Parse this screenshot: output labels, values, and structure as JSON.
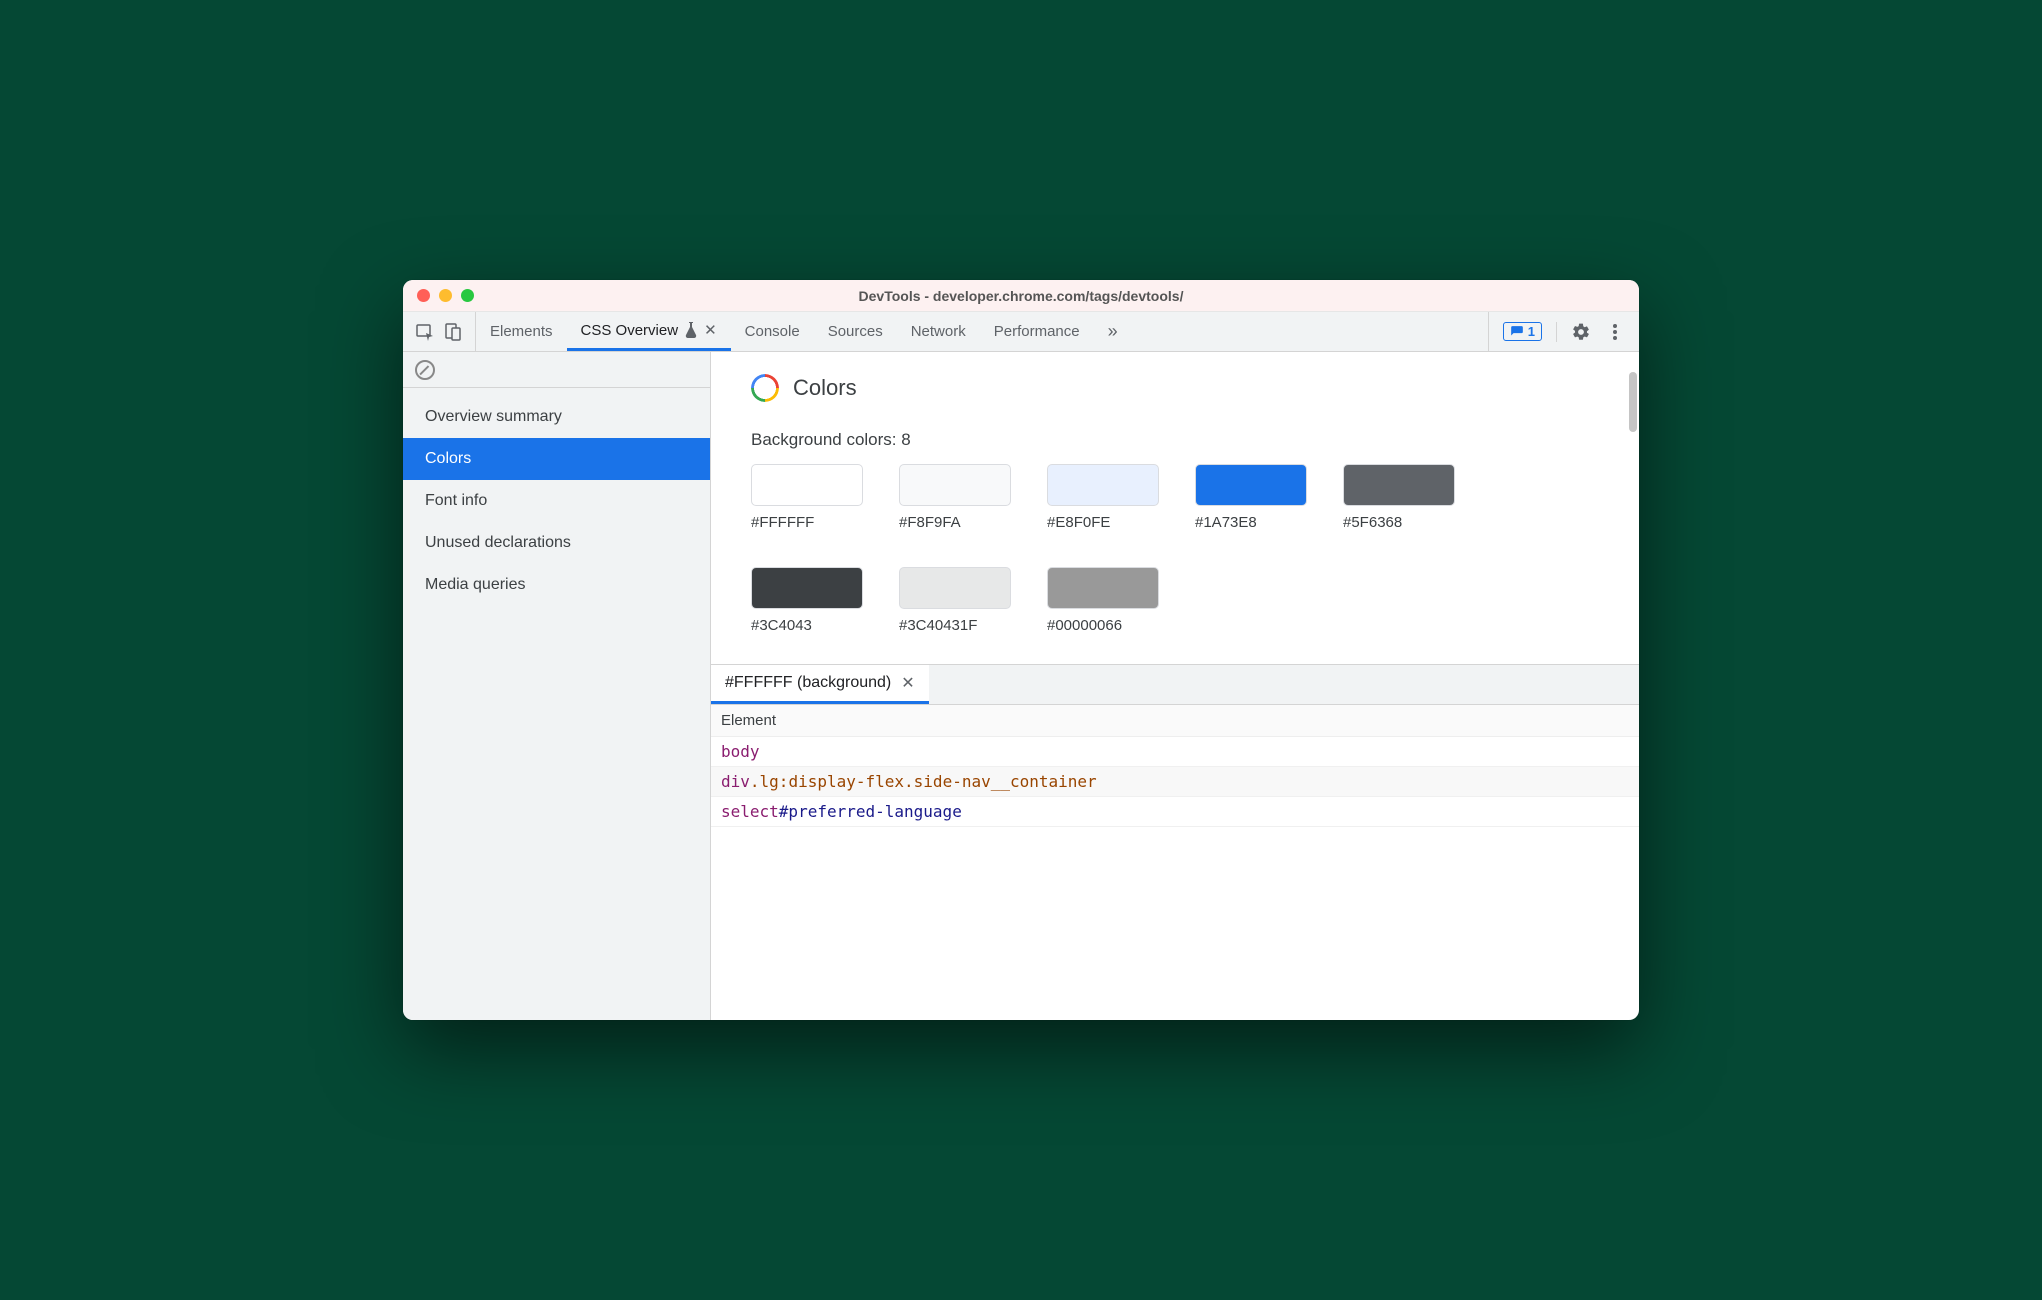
{
  "window": {
    "title": "DevTools - developer.chrome.com/tags/devtools/"
  },
  "tabs": {
    "items": [
      {
        "label": "Elements"
      },
      {
        "label": "CSS Overview"
      },
      {
        "label": "Console"
      },
      {
        "label": "Sources"
      },
      {
        "label": "Network"
      },
      {
        "label": "Performance"
      }
    ],
    "issues_count": "1"
  },
  "sidebar": {
    "items": [
      {
        "label": "Overview summary"
      },
      {
        "label": "Colors"
      },
      {
        "label": "Font info"
      },
      {
        "label": "Unused declarations"
      },
      {
        "label": "Media queries"
      }
    ]
  },
  "section": {
    "title": "Colors",
    "subtitle": "Background colors: 8",
    "swatches": [
      {
        "hex": "#FFFFFF",
        "css": "#FFFFFF"
      },
      {
        "hex": "#F8F9FA",
        "css": "#F8F9FA"
      },
      {
        "hex": "#E8F0FE",
        "css": "#E8F0FE"
      },
      {
        "hex": "#1A73E8",
        "css": "#1A73E8"
      },
      {
        "hex": "#5F6368",
        "css": "#5F6368"
      },
      {
        "hex": "#3C4043",
        "css": "#3C4043"
      },
      {
        "hex": "#3C40431F",
        "css": "rgba(60,64,67,0.12)"
      },
      {
        "hex": "#00000066",
        "css": "rgba(0,0,0,0.40)"
      }
    ]
  },
  "details": {
    "tab_label": "#FFFFFF (background)",
    "header": "Element",
    "rows": [
      {
        "tag": "body",
        "rest": ""
      },
      {
        "tag": "div",
        "rest": ".lg:display-flex.side-nav__container",
        "rest_kind": "class"
      },
      {
        "tag": "select",
        "rest": "#preferred-language",
        "rest_kind": "id"
      }
    ]
  }
}
